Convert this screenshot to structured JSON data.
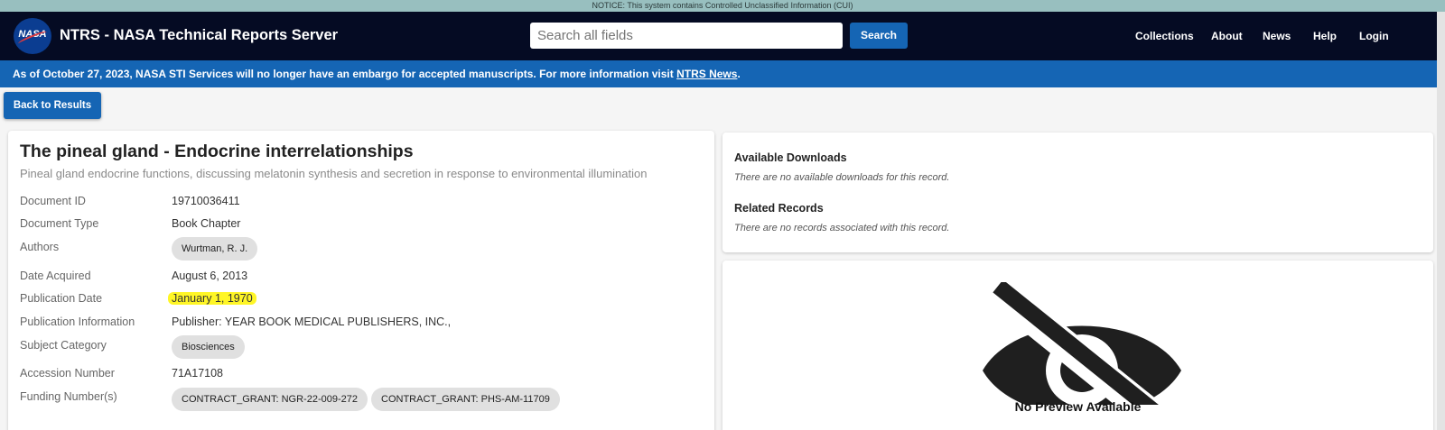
{
  "notice": "NOTICE: This system contains Controlled Unclassified Information (CUI)",
  "header": {
    "logo_text": "NASA",
    "title": "NTRS - NASA Technical Reports Server",
    "search_placeholder": "Search all fields",
    "search_button": "Search",
    "nav": [
      "Collections",
      "About",
      "News",
      "Help",
      "Login"
    ]
  },
  "announcement": {
    "text": "As of October 27, 2023, NASA STI Services will no longer have an embargo for accepted manuscripts. For more information visit ",
    "link": "NTRS News",
    "suffix": "."
  },
  "back_button": "Back to Results",
  "record": {
    "title": "The pineal gland - Endocrine interrelationships",
    "subtitle": "Pineal gland endocrine functions, discussing melatonin synthesis and secretion in response to environmental illumination",
    "fields": {
      "document_id": {
        "label": "Document ID",
        "value": "19710036411"
      },
      "document_type": {
        "label": "Document Type",
        "value": "Book Chapter"
      },
      "authors": {
        "label": "Authors",
        "chips": [
          "Wurtman, R. J."
        ]
      },
      "date_acquired": {
        "label": "Date Acquired",
        "value": "August 6, 2013"
      },
      "publication_date": {
        "label": "Publication Date",
        "value": "January 1, 1970"
      },
      "publication_info": {
        "label": "Publication Information",
        "value": "Publisher: YEAR BOOK MEDICAL PUBLISHERS, INC.,"
      },
      "subject_category": {
        "label": "Subject Category",
        "chips": [
          "Biosciences"
        ]
      },
      "accession_number": {
        "label": "Accession Number",
        "value": "71A17108"
      },
      "funding_numbers": {
        "label": "Funding Number(s)",
        "chips": [
          "CONTRACT_GRANT: NGR-22-009-272",
          "CONTRACT_GRANT: PHS-AM-11709"
        ]
      }
    }
  },
  "downloads": {
    "heading": "Available Downloads",
    "text": "There are no available downloads for this record."
  },
  "related": {
    "heading": "Related Records",
    "text": "There are no records associated with this record."
  },
  "preview": {
    "icon": "eye-slash-icon",
    "text": "No Preview Available"
  },
  "colors": {
    "header_bg": "#050b23",
    "accent": "#1565b4",
    "highlight": "#fff500",
    "notice_bg": "#98bfbf"
  }
}
